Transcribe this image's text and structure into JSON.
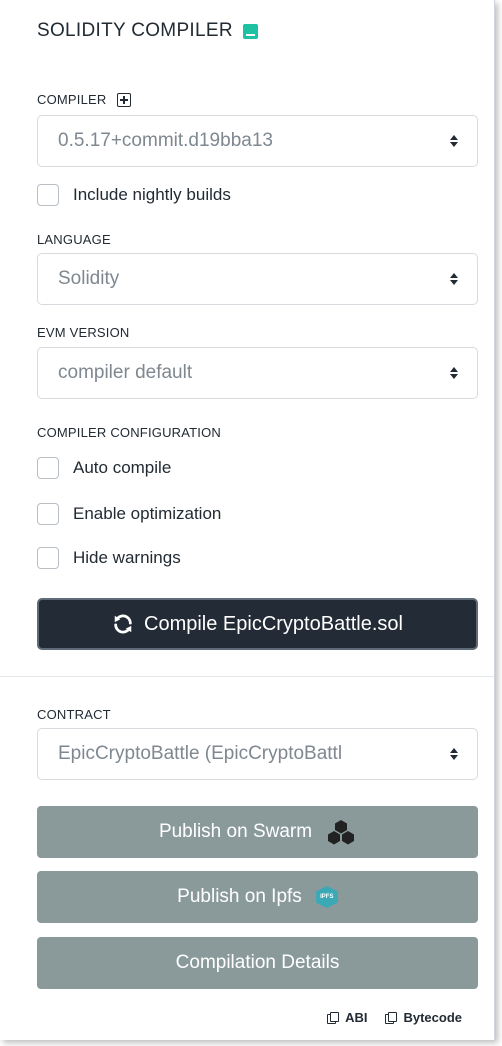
{
  "header": {
    "title": "SOLIDITY COMPILER"
  },
  "compiler": {
    "label": "COMPILER",
    "version": "0.5.17+commit.d19bba13",
    "nightly_label": "Include nightly builds"
  },
  "language": {
    "label": "LANGUAGE",
    "value": "Solidity"
  },
  "evm": {
    "label": "EVM VERSION",
    "value": "compiler default"
  },
  "config": {
    "label": "COMPILER CONFIGURATION",
    "options": [
      "Auto compile",
      "Enable optimization",
      "Hide warnings"
    ]
  },
  "compile_button": {
    "label": "Compile EpicCryptoBattle.sol"
  },
  "contract": {
    "label": "CONTRACT",
    "value": "EpicCryptoBattle (EpicCryptoBattl"
  },
  "actions": {
    "swarm": "Publish on Swarm",
    "ipfs": "Publish on Ipfs",
    "ipfs_icon_text": "IPFS",
    "details": "Compilation Details"
  },
  "links": {
    "abi": "ABI",
    "bytecode": "Bytecode"
  },
  "colors": {
    "accent": "#1ec2a3",
    "dark_button": "#222b36",
    "grey_button": "#8a9a9b"
  },
  "icons": {
    "header": "book-icon",
    "compiler": "plus-square-icon",
    "compile": "refresh-icon",
    "swarm": "swarm-icon",
    "ipfs": "ipfs-icon",
    "copy": "copy-icon"
  }
}
